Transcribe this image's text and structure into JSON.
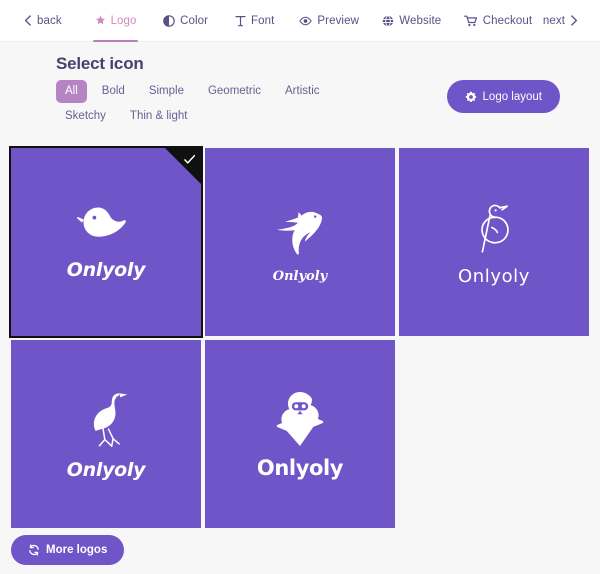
{
  "nav": {
    "back_label": "back",
    "next_label": "next",
    "items": [
      {
        "label": "Logo",
        "icon": "star-icon",
        "active": true
      },
      {
        "label": "Color",
        "icon": "contrast-icon",
        "active": false
      },
      {
        "label": "Font",
        "icon": "text-type-icon",
        "active": false
      },
      {
        "label": "Preview",
        "icon": "eye-icon",
        "active": false
      },
      {
        "label": "Website",
        "icon": "globe-icon",
        "active": false
      },
      {
        "label": "Checkout",
        "icon": "cart-icon",
        "active": false
      }
    ]
  },
  "main": {
    "title": "Select icon",
    "filters": [
      {
        "label": "All",
        "active": true
      },
      {
        "label": "Bold",
        "active": false
      },
      {
        "label": "Simple",
        "active": false
      },
      {
        "label": "Geometric",
        "active": false
      },
      {
        "label": "Artistic",
        "active": false
      },
      {
        "label": "Sketchy",
        "active": false
      },
      {
        "label": "Thin & light",
        "active": false
      }
    ],
    "logo_layout_label": "Logo layout",
    "logo_layout_icon": "gear-icon",
    "more_logos_label": "More logos",
    "more_logos_icon": "refresh-icon",
    "cards": [
      {
        "wordmark": "Onlyoly",
        "icon": "chubby-bird-icon",
        "selected": true
      },
      {
        "wordmark": "Onlyoly",
        "icon": "flying-swift-icon",
        "selected": false
      },
      {
        "wordmark": "Onlyoly",
        "icon": "line-art-bird-icon",
        "selected": false
      },
      {
        "wordmark": "Onlyoly",
        "icon": "heron-bird-icon",
        "selected": false
      },
      {
        "wordmark": "Onlyoly",
        "icon": "owl-bird-icon",
        "selected": false
      }
    ]
  },
  "colors": {
    "card_purple": "#6f55c7",
    "accent_pink": "#cf8bc0",
    "filter_active": "#b584c4",
    "nav_text": "#5b4f86",
    "page_bg": "#f7f7f8",
    "selected_border": "#101010"
  }
}
